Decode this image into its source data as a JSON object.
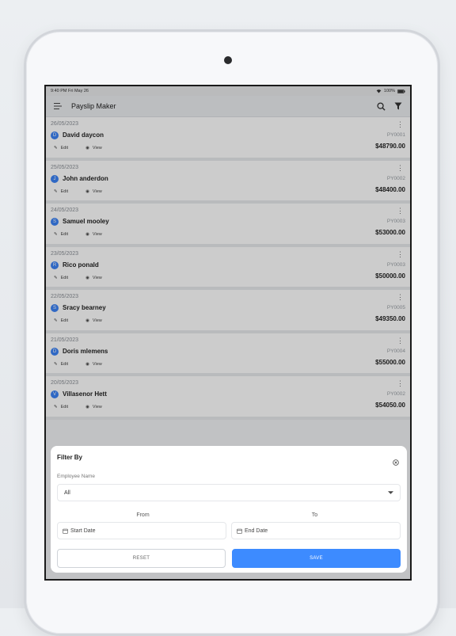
{
  "status_bar": {
    "time": "9:40 PM",
    "day": "Fri May 26",
    "battery": "100%"
  },
  "app": {
    "title": "Payslip Maker"
  },
  "actions": {
    "edit": "Edit",
    "view": "View"
  },
  "payslips": [
    {
      "date": "26/05/2023",
      "initial": "D",
      "name": "David daycon",
      "id": "PY0001",
      "amount": "$48790.00"
    },
    {
      "date": "25/05/2023",
      "initial": "J",
      "name": "John anderdon",
      "id": "PY0002",
      "amount": "$48400.00"
    },
    {
      "date": "24/05/2023",
      "initial": "S",
      "name": "Samuel mooley",
      "id": "PY0003",
      "amount": "$53000.00"
    },
    {
      "date": "23/05/2023",
      "initial": "R",
      "name": "Rico ponald",
      "id": "PY0003",
      "amount": "$50000.00"
    },
    {
      "date": "22/05/2023",
      "initial": "S",
      "name": "Sracy bearney",
      "id": "PY0005",
      "amount": "$49350.00"
    },
    {
      "date": "21/05/2023",
      "initial": "D",
      "name": "Doris mlemens",
      "id": "PY0004",
      "amount": "$55000.00"
    },
    {
      "date": "20/05/2023",
      "initial": "V",
      "name": "Villasenor Hett",
      "id": "PY0002",
      "amount": "$54050.00"
    }
  ],
  "filter": {
    "title": "Filter By",
    "employee_label": "Employee Name",
    "employee_value": "All",
    "from_label": "From",
    "to_label": "To",
    "start_date": "Start Date",
    "end_date": "End Date",
    "reset": "RESET",
    "save": "SAVE"
  }
}
